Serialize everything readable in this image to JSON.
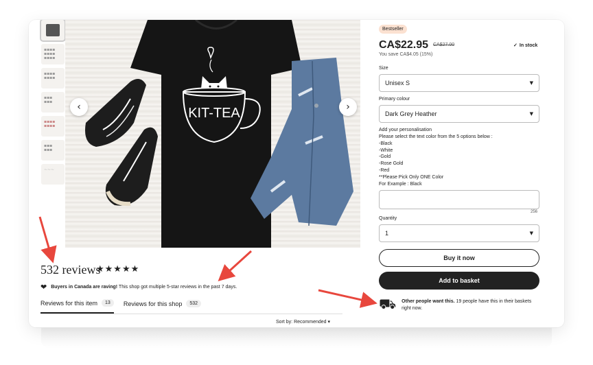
{
  "product": {
    "badge": "Bestseller",
    "price": "CA$22.95",
    "old_price": "CA$27.00",
    "stock": "In stock",
    "savings": "You save CA$4.05 (15%)"
  },
  "options": {
    "size_label": "Size",
    "size_value": "Unisex S",
    "colour_label": "Primary colour",
    "colour_value": "Dark Grey Heather",
    "personalisation_label": "Add your personalisation",
    "personalisation_lines": [
      "Please select the text color from the 5 options below :",
      "-Black",
      "-White",
      "-Gold",
      "-Rose Gold",
      "-Red",
      "**Please Pick Only ONE Color",
      "For Example : Black"
    ],
    "char_count": "256",
    "quantity_label": "Quantity",
    "quantity_value": "1"
  },
  "actions": {
    "buy_now": "Buy it now",
    "add_to_basket": "Add to basket"
  },
  "social_proof": {
    "bold": "Other people want this.",
    "rest": " 19 people have this in their baskets right now."
  },
  "reviews": {
    "title": "532 reviews",
    "stars": "★★★★★",
    "raving_bold": "Buyers in Canada are raving!",
    "raving_rest": " This shop got multiple 5-star reviews in the past 7 days.",
    "tabs": [
      {
        "label": "Reviews for this item",
        "count": "13"
      },
      {
        "label": "Reviews for this shop",
        "count": "532"
      }
    ],
    "sort_label": "Sort by: Recommended"
  },
  "image": {
    "shirt_text": "KIT-TEA"
  },
  "colors": {
    "badge_bg": "#fbe1d1",
    "button_dark": "#222222",
    "annotation_arrow": "#e8473d"
  }
}
